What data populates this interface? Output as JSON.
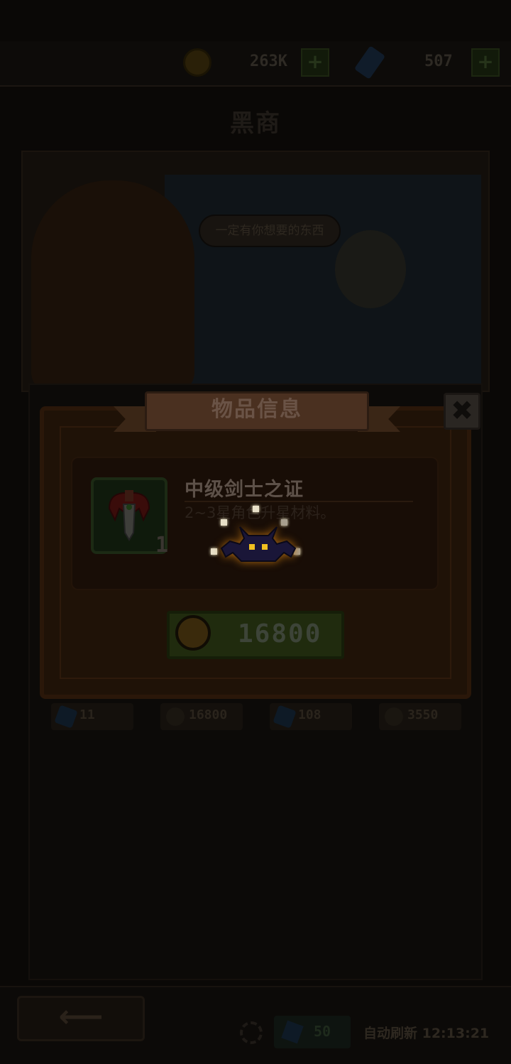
{
  "top_bar": {
    "gold": "263K",
    "gems": "507",
    "plus_label": "+"
  },
  "shop": {
    "title": "黑商",
    "banner_speech": "一定有你想要的东西"
  },
  "price_tags": [
    "11",
    "16800",
    "108",
    "3550"
  ],
  "modal": {
    "title": "物品信息",
    "close_label": "✖",
    "item_name": "中级剑士之证",
    "item_desc": "2~3星角色升星材料。",
    "quantity": "1",
    "price": "16800"
  },
  "bottom_bar": {
    "back_label": "⟵",
    "refresh_cost": "50",
    "auto_refresh": "自动刷新 12:13:21"
  },
  "icons": [
    "gold-coin-icon",
    "gem-icon",
    "sword-emblem-icon",
    "refresh-icon",
    "close-icon",
    "back-arrow-icon",
    "bat-loading-icon"
  ],
  "colors": {
    "modal_bg": "#1f1207",
    "buy_button": "#202b0e",
    "bat_eyes": "#f0c020"
  }
}
